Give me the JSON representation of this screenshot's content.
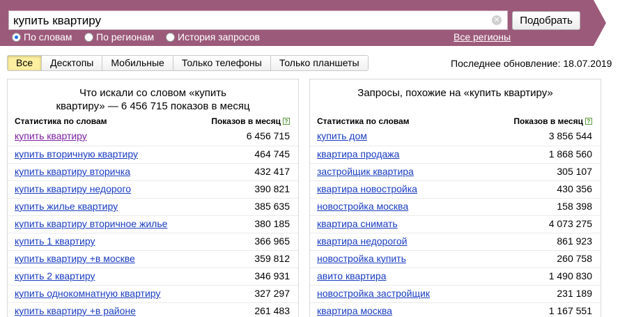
{
  "search": {
    "query": "купить квартиру",
    "clear_icon": "✕",
    "submit_label": "Подобрать",
    "modes": [
      {
        "label": "По словам",
        "selected": true
      },
      {
        "label": "По регионам",
        "selected": false
      },
      {
        "label": "История запросов",
        "selected": false
      }
    ],
    "regions_link": "Все регионы",
    "band_color": "#9c5a7a"
  },
  "device_tabs": [
    {
      "label": "Все",
      "active": true
    },
    {
      "label": "Десктопы",
      "active": false
    },
    {
      "label": "Мобильные",
      "active": false
    },
    {
      "label": "Только телефоны",
      "active": false
    },
    {
      "label": "Только планшеты",
      "active": false
    }
  ],
  "last_update": "Последнее обновление: 18.07.2019",
  "left_panel": {
    "title_line1": "Что искали со словом «купить",
    "title_line2": "квартиру» — 6 456 715 показов в месяц",
    "col_words": "Статистика по словам",
    "col_shows": "Показов в месяц",
    "help_icon": "?",
    "rows": [
      {
        "query": "купить квартиру",
        "count": "6 456 715"
      },
      {
        "query": "купить вторичную квартиру",
        "count": "464 745"
      },
      {
        "query": "купить квартиру вторичка",
        "count": "432 417"
      },
      {
        "query": "купить квартиру недорого",
        "count": "390 821"
      },
      {
        "query": "купить жилье квартиру",
        "count": "385 635"
      },
      {
        "query": "купить квартиру вторичное жилье",
        "count": "380 185"
      },
      {
        "query": "купить 1 квартиру",
        "count": "366 965"
      },
      {
        "query": "купить квартиру +в москве",
        "count": "359 812"
      },
      {
        "query": "купить 2 квартиру",
        "count": "346 931"
      },
      {
        "query": "купить однокомнатную квартиру",
        "count": "327 297"
      },
      {
        "query": "купить квартиру +в районе",
        "count": "261 483"
      }
    ]
  },
  "right_panel": {
    "title_line1": "Запросы, похожие на «купить квартиру»",
    "col_words": "Статистика по словам",
    "col_shows": "Показов в месяц",
    "help_icon": "?",
    "rows": [
      {
        "query": "купить дом",
        "count": "3 856 544"
      },
      {
        "query": "квартира продажа",
        "count": "1 868 560"
      },
      {
        "query": "застройщик квартира",
        "count": "305 107"
      },
      {
        "query": "квартира новостройка",
        "count": "430 356"
      },
      {
        "query": "новостройка москва",
        "count": "158 398"
      },
      {
        "query": "квартира снимать",
        "count": "4 073 275"
      },
      {
        "query": "квартира недорогой",
        "count": "861 923"
      },
      {
        "query": "новостройка купить",
        "count": "260 758"
      },
      {
        "query": "авито квартира",
        "count": "1 490 830"
      },
      {
        "query": "новостройка застройщик",
        "count": "231 189"
      },
      {
        "query": "квартира москва",
        "count": "1 167 551"
      }
    ]
  }
}
